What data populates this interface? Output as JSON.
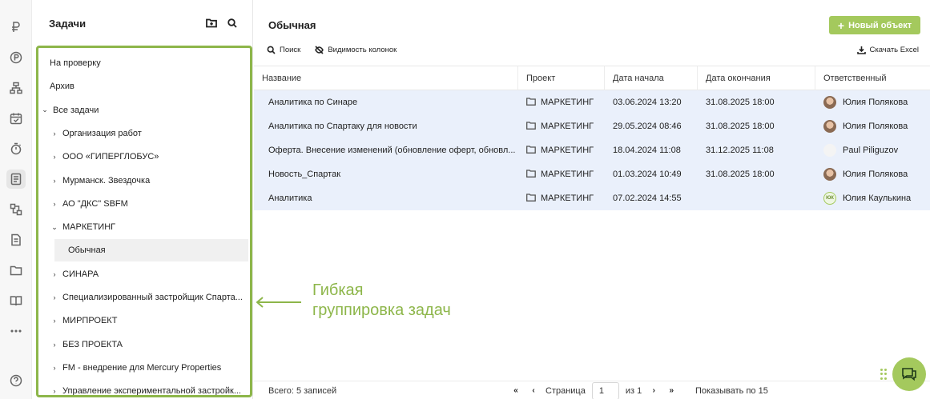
{
  "rail": {
    "icons": [
      "ruble-icon",
      "coin-icon",
      "org-structure-icon",
      "calendar-check-icon",
      "stopwatch-icon",
      "tasks-icon",
      "process-icon",
      "document-icon",
      "folder-icon",
      "book-icon",
      "more-icon",
      "help-icon"
    ],
    "active": "tasks-icon"
  },
  "tree": {
    "title": "Задачи",
    "items": [
      {
        "label": "На проверку",
        "chevron": ""
      },
      {
        "label": "Архив",
        "chevron": ""
      },
      {
        "label": "Все задачи",
        "chevron": "⌄"
      },
      {
        "label": "Организация работ",
        "chevron": "›"
      },
      {
        "label": "ООО «ГИПЕРГЛОБУС»",
        "chevron": "›"
      },
      {
        "label": "Мурманск. Звездочка",
        "chevron": "›"
      },
      {
        "label": "АО \"ДКС\" SBFM",
        "chevron": "›"
      },
      {
        "label": "МАРКЕТИНГ",
        "chevron": "⌄"
      },
      {
        "label": "Обычная",
        "chevron": ""
      },
      {
        "label": "СИНАРА",
        "chevron": "›"
      },
      {
        "label": "Специализированный застройщик Спарта...",
        "chevron": "›"
      },
      {
        "label": "МИРПРОЕКТ",
        "chevron": "›"
      },
      {
        "label": "БЕЗ ПРОЕКТА",
        "chevron": "›"
      },
      {
        "label": "FM - внедрение для Mercury Properties",
        "chevron": "›"
      },
      {
        "label": "Управление экспериментальной застройк...",
        "chevron": "›"
      }
    ],
    "selected_index": 8
  },
  "main": {
    "title": "Обычная",
    "new_button": "Новый объект",
    "toolbar": {
      "search": "Поиск",
      "columns": "Видимость колонок",
      "excel": "Скачать Excel"
    },
    "columns": [
      "Название",
      "Проект",
      "Дата начала",
      "Дата окончания",
      "Ответственный"
    ],
    "rows": [
      {
        "name": "Аналитика по Синаре",
        "project": "МАРКЕТИНГ",
        "start": "03.06.2024 13:20",
        "end": "31.08.2025 18:00",
        "owner": "Юлия Полякова",
        "avatar": "photo"
      },
      {
        "name": "Аналитика по Спартаку для новости",
        "project": "МАРКЕТИНГ",
        "start": "29.05.2024 08:46",
        "end": "31.08.2025 18:00",
        "owner": "Юлия Полякова",
        "avatar": "photo"
      },
      {
        "name": "Оферта. Внесение изменений (обновление оферт, обновл...",
        "project": "МАРКЕТИНГ",
        "start": "18.04.2024 11:08",
        "end": "31.12.2025 11:08",
        "owner": "Paul Piliguzov",
        "avatar": "blank"
      },
      {
        "name": "Новость_Спартак",
        "project": "МАРКЕТИНГ",
        "start": "01.03.2024 10:49",
        "end": "31.08.2025 18:00",
        "owner": "Юлия Полякова",
        "avatar": "photo"
      },
      {
        "name": "Аналитика",
        "project": "МАРКЕТИНГ",
        "start": "07.02.2024 14:55",
        "end": "",
        "owner": "Юлия Каулькина",
        "avatar": "initials",
        "initials": "ЮК"
      }
    ]
  },
  "annotation": {
    "line1": "Гибкая",
    "line2": "группировка задач"
  },
  "footer": {
    "total": "Всего: 5 записей",
    "page_label": "Страница",
    "page_value": "1",
    "of_label": "из 1",
    "show_label": "Показывать по 15"
  },
  "colors": {
    "accent": "#a4c95d",
    "row_highlight": "#eaf0fb"
  }
}
